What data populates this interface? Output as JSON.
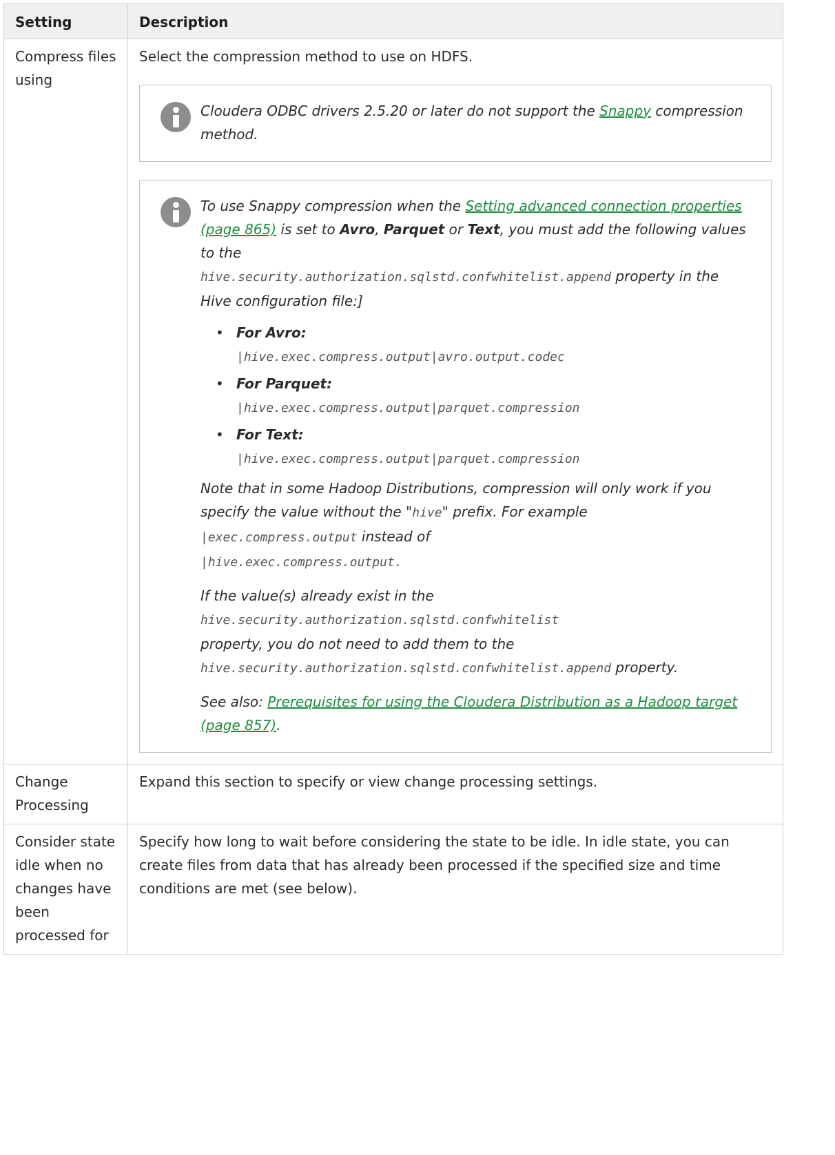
{
  "table": {
    "headers": {
      "setting": "Setting",
      "description": "Description"
    },
    "rows": [
      {
        "setting": "Compress files using",
        "description": "Select the compression method to use on HDFS.",
        "note1": {
          "text_before": "Cloudera ODBC drivers 2.5.20 or later do not support the ",
          "link": "Snappy",
          "text_after": " compression method."
        },
        "note2": {
          "intro_before": "To use Snappy compression when the ",
          "intro_link": "Setting advanced connection properties (page 865)",
          "intro_mid": " is set to ",
          "fmt_avro": "Avro",
          "sep1": ", ",
          "fmt_parquet": "Parquet",
          "sep2": " or ",
          "fmt_text": "Text",
          "intro_after": ", you must add the following values to the ",
          "property_append": "hive.security.authorization.sqlstd.confwhitelist.append",
          "intro_end": " property in the Hive configuration file:]",
          "items": [
            {
              "label": "For Avro:",
              "value": "|hive.exec.compress.output|avro.output.codec"
            },
            {
              "label": "For Parquet:",
              "value": "|hive.exec.compress.output|parquet.compression"
            },
            {
              "label": "For Text:",
              "value": "|hive.exec.compress.output|parquet.compression"
            }
          ],
          "note_before": "Note that in some Hadoop Distributions, compression will only work if you specify the value without the \"",
          "note_hive": "hive",
          "note_mid": "\" prefix. For example ",
          "note_example1": "|exec.compress.output",
          "note_instead": " instead of ",
          "note_example2": "|hive.exec.compress.output.",
          "exist_before": "If the value(s) already exist in the ",
          "exist_property": "hive.security.authorization.sqlstd.confwhitelist",
          "exist_mid": " property, you do not need to add them to the ",
          "exist_property_append": "hive.security.authorization.sqlstd.confwhitelist.append",
          "exist_end": " property.",
          "see_also_before": "See also: ",
          "see_also_link": "Prerequisites for using the Cloudera Distribution as a Hadoop target (page 857)",
          "see_also_end": "."
        }
      },
      {
        "setting": "Change Processing",
        "description": "Expand this section to specify or view change processing settings."
      },
      {
        "setting": "Consider state idle when no changes have been processed for",
        "description": "Specify how long to wait before considering the state to be idle. In idle state, you can create files from data that has already been processed if the specified size and time conditions are met (see below)."
      }
    ]
  },
  "icons": {
    "note": "info-icon"
  },
  "colors": {
    "link": "#1a8e3c",
    "header_bg": "#f0f0f0",
    "border": "#cfcfcf",
    "icon": "#8d8d8d"
  }
}
